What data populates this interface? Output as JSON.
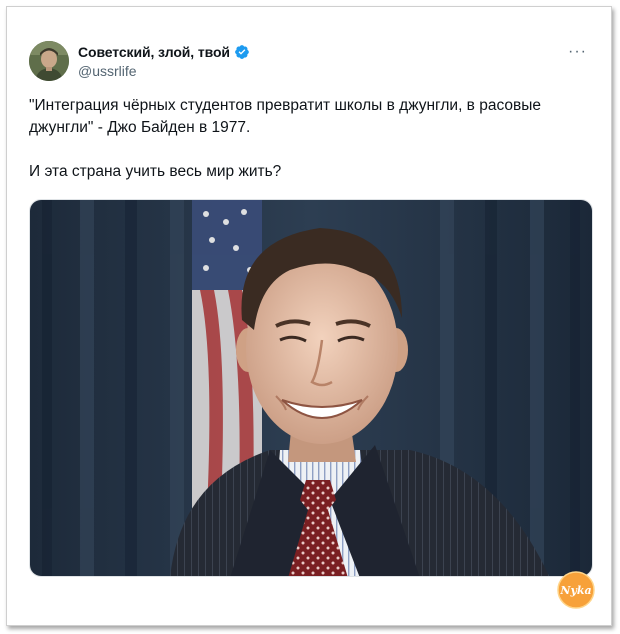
{
  "tweet": {
    "author_name": "Советский, злой, твой",
    "author_handle": "@ussrlife",
    "text": "\"Интеграция чёрных студентов превратит школы в джунгли, в расовые\nджунгли\" - Джо Байден в 1977.\n\nИ эта страна учить весь мир жить?",
    "more_label": "···"
  },
  "icons": {
    "verified": "verified-badge-icon",
    "more": "more-options-icon",
    "watermark": "nyka-logo-watermark"
  },
  "colors": {
    "verified": "#1d9bf0",
    "text": "#0f1419",
    "secondary": "#536471",
    "watermark": "#f7a13a"
  },
  "watermark": {
    "text": "Nyka"
  }
}
